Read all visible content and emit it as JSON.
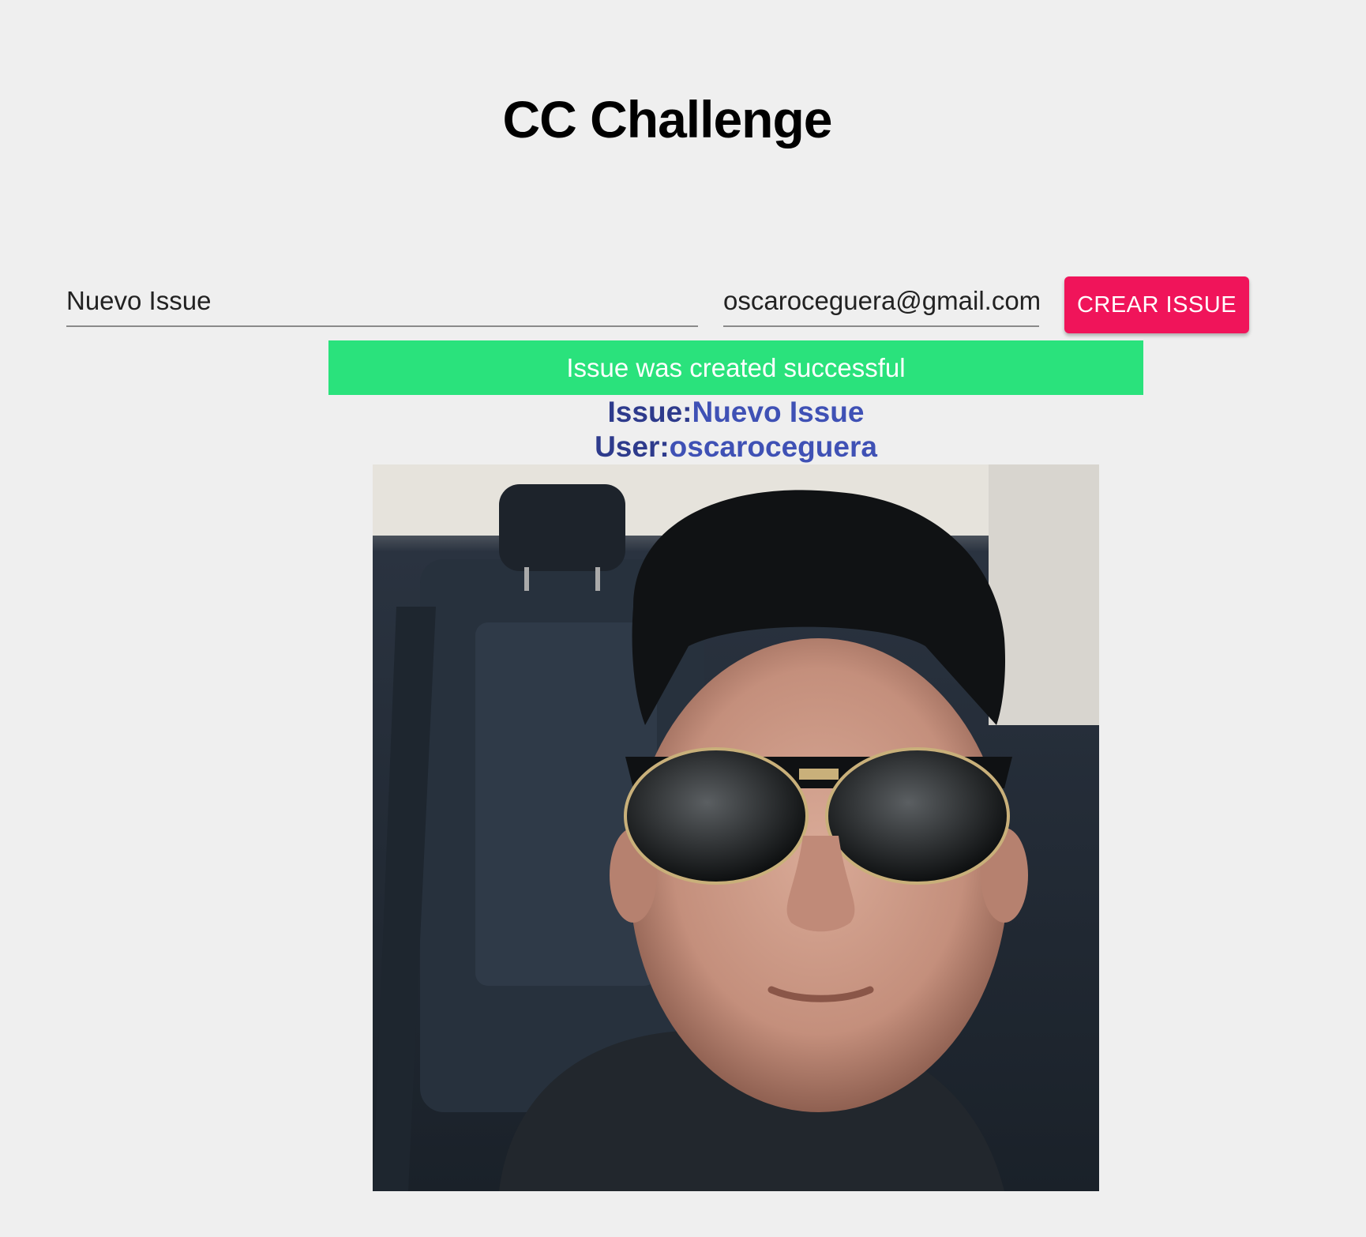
{
  "header": {
    "title": "CC Challenge"
  },
  "form": {
    "issue_value": "Nuevo Issue",
    "email_value": "oscaroceguera@gmail.com",
    "create_button_label": "CREAR ISSUE"
  },
  "status": {
    "message": "Issue was created successful",
    "color": "#2ae27c"
  },
  "result": {
    "issue_label": "Issue:",
    "issue_value": "Nuevo Issue",
    "user_label": "User:",
    "user_value": "oscaroceguera"
  },
  "colors": {
    "accent": "#f0145a",
    "label": "#2e3b8c",
    "link": "#3f51b5",
    "background": "#efefef"
  }
}
